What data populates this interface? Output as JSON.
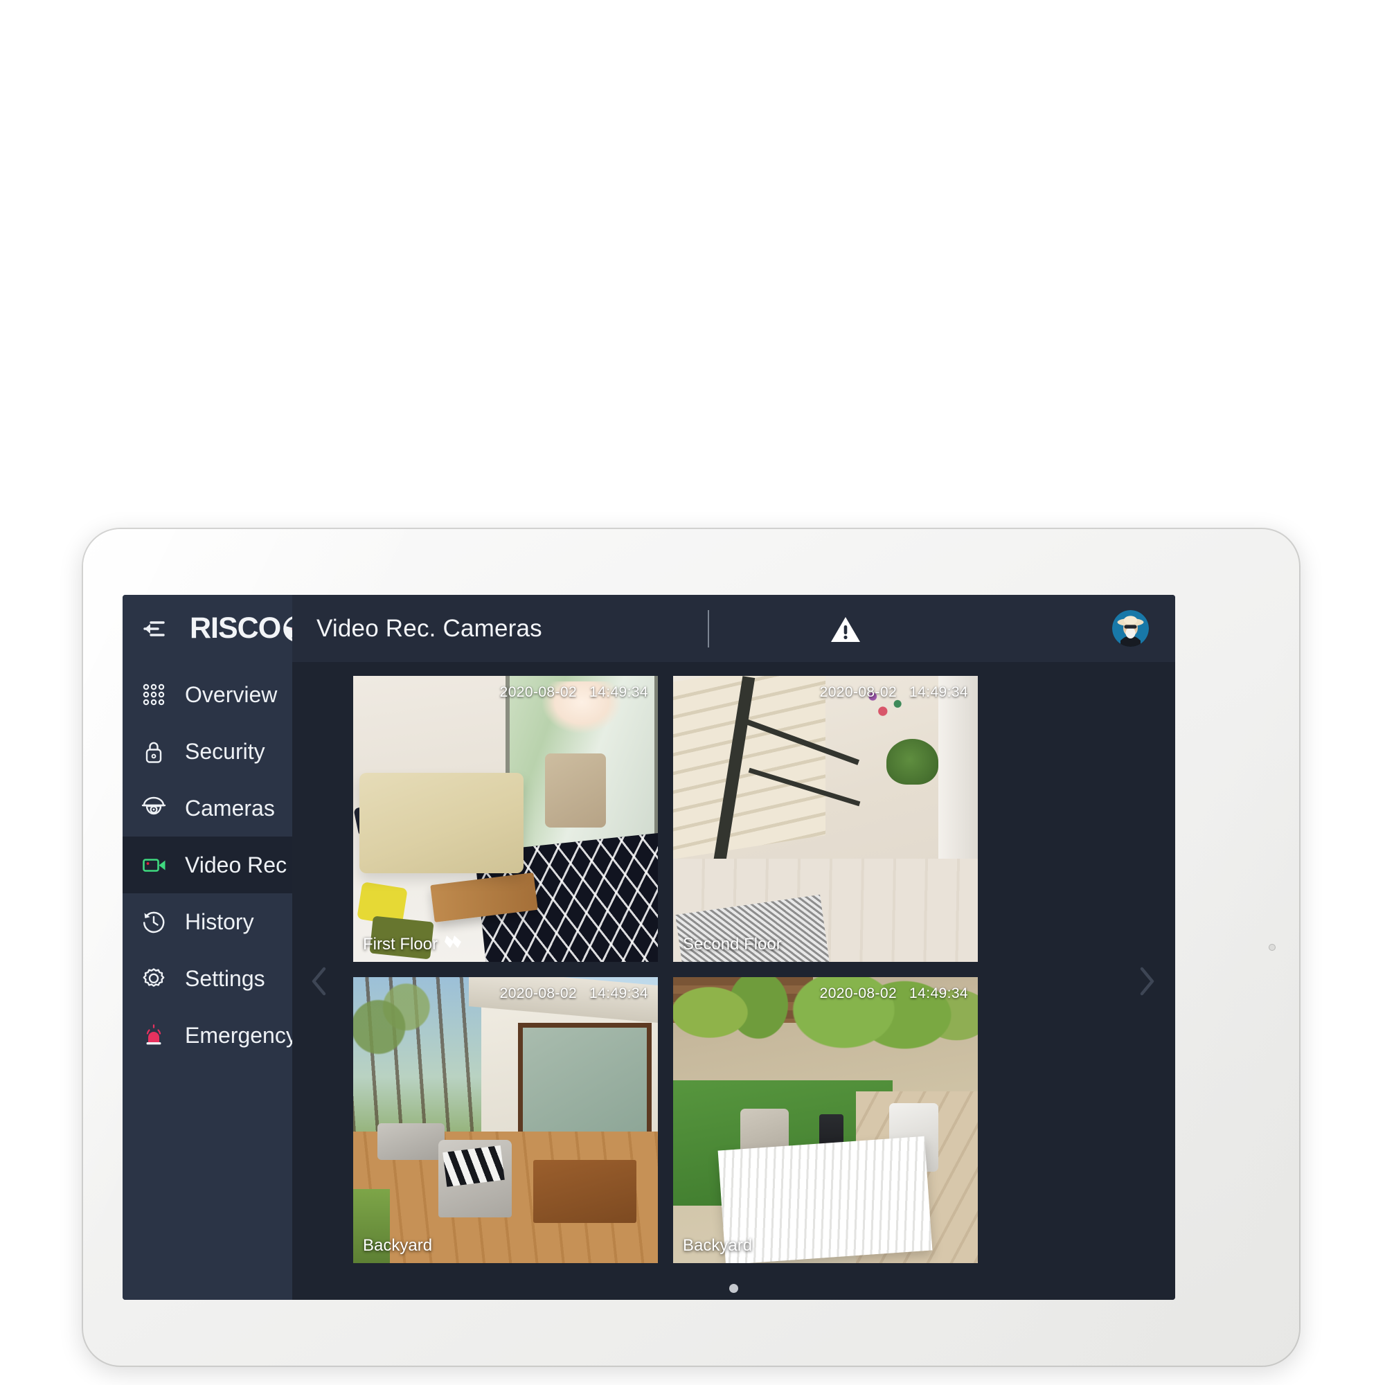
{
  "header": {
    "back_icon": "back-arrow-menu-icon",
    "brand": "RISCO",
    "brand_mark": "risco-iris-logo",
    "page_title": "Video Rec. Cameras",
    "alert_icon": "warning-triangle-icon",
    "avatar": "user-avatar"
  },
  "sidebar": {
    "items": [
      {
        "label": "Overview",
        "icon": "grid-dots-icon",
        "active": false
      },
      {
        "label": "Security",
        "icon": "padlock-icon",
        "active": false
      },
      {
        "label": "Cameras",
        "icon": "dome-camera-icon",
        "active": false
      },
      {
        "label": "Video Rec",
        "icon": "video-camera-icon",
        "active": true
      },
      {
        "label": "History",
        "icon": "clock-history-icon",
        "active": false
      },
      {
        "label": "Settings",
        "icon": "gear-icon",
        "active": false
      },
      {
        "label": "Emergency",
        "icon": "siren-alarm-icon",
        "active": false
      }
    ]
  },
  "carousel": {
    "prev_icon": "chevron-left-icon",
    "next_icon": "chevron-right-icon",
    "page_dots": 1,
    "active_dot": 0
  },
  "cameras": [
    {
      "name": "First Floor",
      "date": "2020-08-02",
      "time": "14:49:34",
      "playing": true,
      "play_icon": "double-chevron-icon",
      "scene": "living-room"
    },
    {
      "name": "Second Floor",
      "date": "2020-08-02",
      "time": "14:49:34",
      "playing": false,
      "play_icon": "",
      "scene": "staircase"
    },
    {
      "name": "Backyard",
      "date": "2020-08-02",
      "time": "14:49:34",
      "playing": false,
      "play_icon": "",
      "scene": "deck"
    },
    {
      "name": "Backyard",
      "date": "2020-08-02",
      "time": "14:49:34",
      "playing": false,
      "play_icon": "",
      "scene": "garden"
    }
  ],
  "colors": {
    "sidebar_bg": "#2b3446",
    "content_bg": "#1e2430",
    "active_item_bg": "#1d2330",
    "accent_green": "#3fd97f",
    "accent_red": "#e0253f",
    "emergency_pink": "#e8315e",
    "text": "#eef1f5"
  }
}
